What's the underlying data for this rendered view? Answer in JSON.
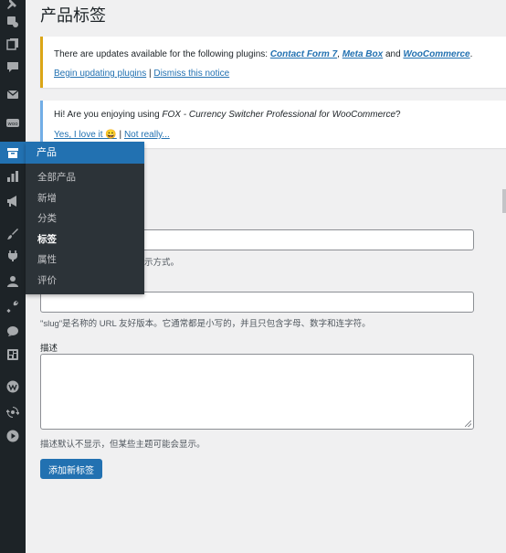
{
  "sidebar": {
    "icons": [
      "pin-icon",
      "media-icon",
      "comments-icon",
      "mail-icon",
      "woocommerce-icon",
      "products-icon",
      "analytics-icon",
      "marketing-icon",
      "appearance-icon",
      "plugins-icon",
      "users-icon",
      "tools-icon",
      "settings-icon",
      "layout-icon",
      "meta-box-icon",
      "sync-icon",
      "play-icon"
    ]
  },
  "flyout": {
    "title": "产品",
    "items": [
      {
        "label": "全部产品"
      },
      {
        "label": "新增"
      },
      {
        "label": "分类"
      },
      {
        "label": "标签",
        "current": true
      },
      {
        "label": "属性"
      },
      {
        "label": "评价"
      }
    ]
  },
  "page": {
    "title": "产品标签"
  },
  "notice_updates": {
    "text_prefix": "There are updates available for the following plugins: ",
    "plugin_1": "Contact Form 7",
    "sep_1": ", ",
    "plugin_2": "Meta Box",
    "sep_2": " and ",
    "plugin_3": "WooCommerce",
    "suffix": ".",
    "begin_link": "Begin updating plugins",
    "divider": " | ",
    "dismiss_link": "Dismiss this notice"
  },
  "notice_fox": {
    "text_prefix": "Hi! Are you enjoying using ",
    "product": "FOX - Currency Switcher Professional for WooCommerce",
    "text_suffix": "?",
    "yes_link": "Yes, I love it 😀",
    "divider": " | ",
    "no_link": "Not really..."
  },
  "form": {
    "name_desc_visible": "示方式。",
    "slug_desc": "\"slug\"是名称的 URL 友好版本。它通常都是小写的，并且只包含字母、数字和连字符。",
    "description_label": "描述",
    "description_desc": "描述默认不显示，但某些主题可能会显示。",
    "submit_label": "添加新标签"
  },
  "colors": {
    "accent": "#2271b1",
    "sidebar_bg": "#1d2327",
    "flyout_bg": "#2c3338",
    "warning_border": "#dba617",
    "info_border": "#72aee6"
  }
}
